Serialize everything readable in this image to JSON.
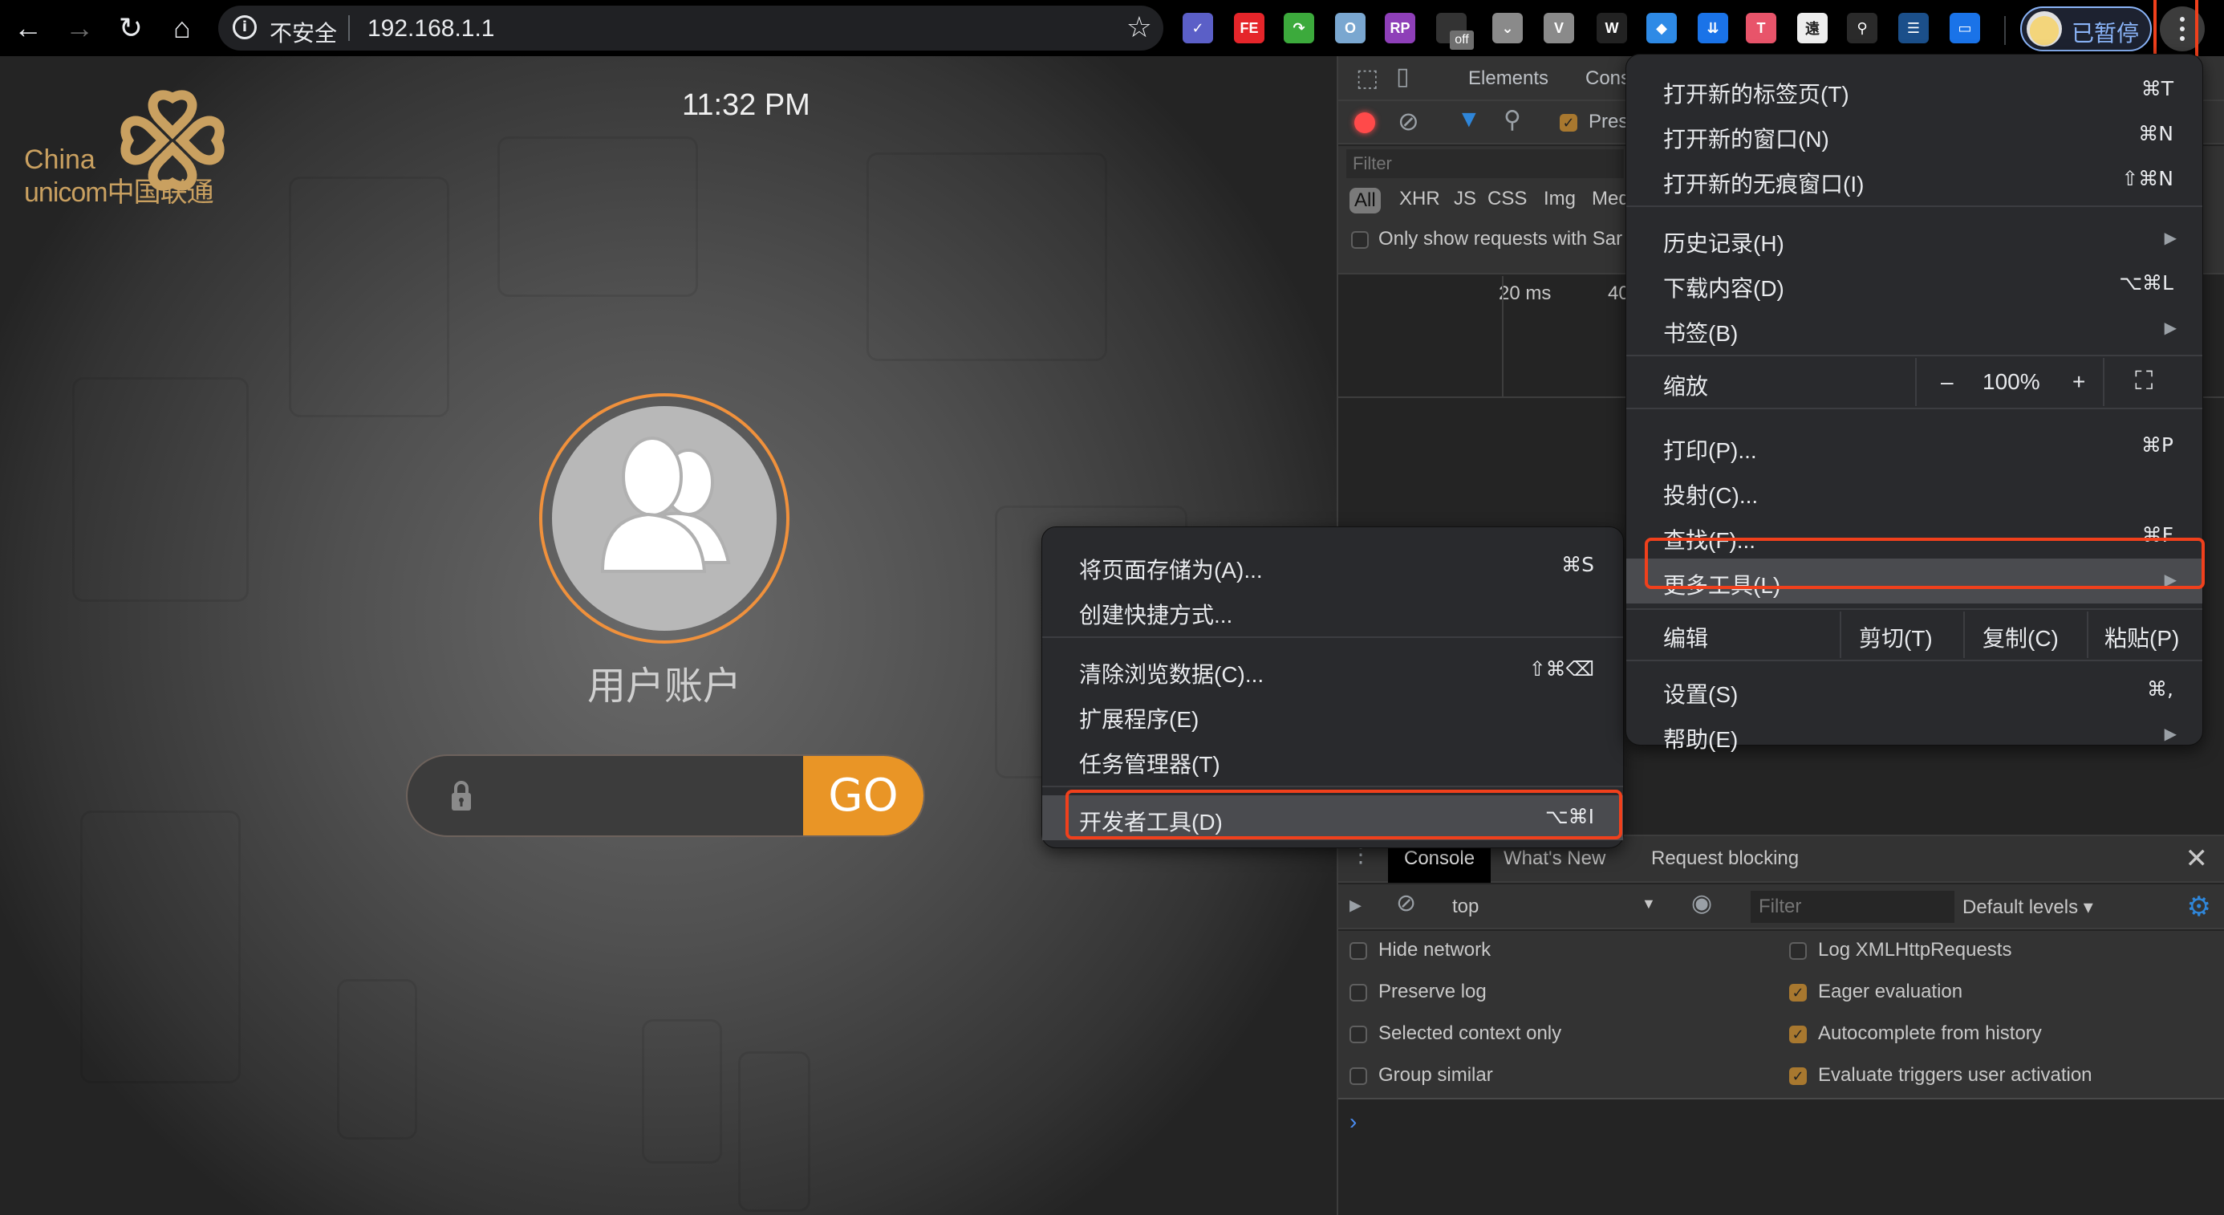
{
  "browser": {
    "security_label": "不安全",
    "url": "192.168.1.1",
    "profile_label": "已暂停",
    "extensions": [
      {
        "name": "checkmark-ext",
        "glyph": "✓",
        "color": "#5b5fc7"
      },
      {
        "name": "fe-helper-ext",
        "glyph": "FE",
        "color": "#e5252a"
      },
      {
        "name": "green-arrow-ext",
        "glyph": "↷",
        "color": "#3caa3c"
      },
      {
        "name": "ring-ext",
        "glyph": "O",
        "color": "#7aa7d0"
      },
      {
        "name": "axure-rp-ext",
        "glyph": "RP",
        "color": "#8e3fb8"
      },
      {
        "name": "off-ext",
        "glyph": "",
        "color": "#333333"
      },
      {
        "name": "pocket-ext",
        "glyph": "⌄",
        "color": "#8a8a8a"
      },
      {
        "name": "vue-devtools-ext",
        "glyph": "V",
        "color": "#8a8a8a"
      },
      {
        "name": "wept-ext",
        "glyph": "W",
        "color": "#222222"
      },
      {
        "name": "diamond-ext",
        "glyph": "◆",
        "color": "#2e8ae6"
      },
      {
        "name": "download-ext",
        "glyph": "⇊",
        "color": "#1a73e8"
      },
      {
        "name": "t-ext",
        "glyph": "T",
        "color": "#e8546a"
      },
      {
        "name": "calligraphy-ext",
        "glyph": "遠",
        "color": "#eeeeee"
      },
      {
        "name": "magnifier-ext",
        "glyph": "⚲",
        "color": "#2a2a2a"
      },
      {
        "name": "database-ext",
        "glyph": "☰",
        "color": "#1b4f8a"
      },
      {
        "name": "monitor-ext",
        "glyph": "▭",
        "color": "#1a73e8"
      }
    ],
    "off_badge": "off"
  },
  "page": {
    "logo_line1": "China",
    "logo_line2": "unicom中国联通",
    "time": "11:32 PM",
    "account_label": "用户账户",
    "password_value": "",
    "go_label": "GO",
    "brand_color": "#e99526"
  },
  "devtools": {
    "tabs": [
      "Elements",
      "Cons"
    ],
    "preserve_label": "Pres",
    "filter_placeholder": "Filter",
    "types": [
      "All",
      "XHR",
      "JS",
      "CSS",
      "Img",
      "Med"
    ],
    "samesite_label": "Only show requests with Sar",
    "timeline_labels": [
      "20 ms",
      "40"
    ],
    "drawer": {
      "tabs": [
        "Console",
        "What's New",
        "Request blocking"
      ],
      "context": "top",
      "filter_placeholder": "Filter",
      "levels": "Default levels ▾",
      "settings_left": [
        {
          "label": "Hide network",
          "checked": false
        },
        {
          "label": "Preserve log",
          "checked": false
        },
        {
          "label": "Selected context only",
          "checked": false
        },
        {
          "label": "Group similar",
          "checked": false
        }
      ],
      "settings_right": [
        {
          "label": "Log XMLHttpRequests",
          "checked": false
        },
        {
          "label": "Eager evaluation",
          "checked": true
        },
        {
          "label": "Autocomplete from history",
          "checked": true
        },
        {
          "label": "Evaluate triggers user activation",
          "checked": true
        }
      ],
      "prompt": "›"
    }
  },
  "main_menu": {
    "items": [
      {
        "label": "打开新的标签页(T)",
        "shortcut": "⌘T"
      },
      {
        "label": "打开新的窗口(N)",
        "shortcut": "⌘N"
      },
      {
        "label": "打开新的无痕窗口(I)",
        "shortcut": "⇧⌘N"
      },
      {
        "label": "历史记录(H)",
        "submenu": true
      },
      {
        "label": "下载内容(D)",
        "shortcut": "⌥⌘L"
      },
      {
        "label": "书签(B)",
        "submenu": true
      },
      {
        "label": "打印(P)...",
        "shortcut": "⌘P"
      },
      {
        "label": "投射(C)..."
      },
      {
        "label": "查找(F)...",
        "shortcut": "⌘F"
      },
      {
        "label": "更多工具(L)",
        "submenu": true,
        "highlighted": true
      },
      {
        "label": "设置(S)",
        "shortcut": "⌘,"
      },
      {
        "label": "帮助(E)",
        "submenu": true
      }
    ],
    "zoom": {
      "label": "缩放",
      "minus": "–",
      "value": "100%",
      "plus": "+"
    },
    "edit": {
      "label": "编辑",
      "cut": "剪切(T)",
      "copy": "复制(C)",
      "paste": "粘贴(P)"
    }
  },
  "more_tools_menu": {
    "items": [
      {
        "label": "将页面存储为(A)...",
        "shortcut": "⌘S"
      },
      {
        "label": "创建快捷方式..."
      },
      {
        "label": "清除浏览数据(C)...",
        "shortcut": "⇧⌘⌫"
      },
      {
        "label": "扩展程序(E)"
      },
      {
        "label": "任务管理器(T)"
      },
      {
        "label": "开发者工具(D)",
        "shortcut": "⌥⌘I",
        "highlighted": true
      }
    ]
  },
  "annotation_color": "#f0401c"
}
